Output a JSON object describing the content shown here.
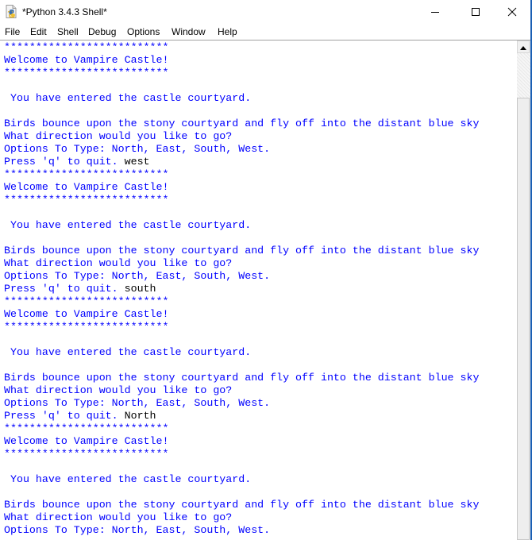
{
  "window": {
    "title": "*Python 3.4.3 Shell*",
    "icon": "idle-python-file-icon",
    "controls": {
      "minimize_icon": "minimize-icon",
      "maximize_icon": "maximize-icon",
      "close_icon": "close-icon"
    }
  },
  "menubar": {
    "items": [
      "File",
      "Edit",
      "Shell",
      "Debug",
      "Options",
      "Window",
      "Help"
    ]
  },
  "colors": {
    "output_text": "#0000ff",
    "input_text": "#000000",
    "background": "#ffffff"
  },
  "shell": {
    "lines": [
      {
        "out": "**************************",
        "in": ""
      },
      {
        "out": "Welcome to Vampire Castle!",
        "in": ""
      },
      {
        "out": "**************************",
        "in": ""
      },
      {
        "out": "",
        "in": ""
      },
      {
        "out": " You have entered the castle courtyard.",
        "in": ""
      },
      {
        "out": "",
        "in": ""
      },
      {
        "out": "Birds bounce upon the stony courtyard and fly off into the distant blue sky",
        "in": ""
      },
      {
        "out": "What direction would you like to go?",
        "in": ""
      },
      {
        "out": "Options To Type: North, East, South, West.",
        "in": ""
      },
      {
        "out": "Press 'q' to quit. ",
        "in": "west"
      },
      {
        "out": "**************************",
        "in": ""
      },
      {
        "out": "Welcome to Vampire Castle!",
        "in": ""
      },
      {
        "out": "**************************",
        "in": ""
      },
      {
        "out": "",
        "in": ""
      },
      {
        "out": " You have entered the castle courtyard.",
        "in": ""
      },
      {
        "out": "",
        "in": ""
      },
      {
        "out": "Birds bounce upon the stony courtyard and fly off into the distant blue sky",
        "in": ""
      },
      {
        "out": "What direction would you like to go?",
        "in": ""
      },
      {
        "out": "Options To Type: North, East, South, West.",
        "in": ""
      },
      {
        "out": "Press 'q' to quit. ",
        "in": "south"
      },
      {
        "out": "**************************",
        "in": ""
      },
      {
        "out": "Welcome to Vampire Castle!",
        "in": ""
      },
      {
        "out": "**************************",
        "in": ""
      },
      {
        "out": "",
        "in": ""
      },
      {
        "out": " You have entered the castle courtyard.",
        "in": ""
      },
      {
        "out": "",
        "in": ""
      },
      {
        "out": "Birds bounce upon the stony courtyard and fly off into the distant blue sky",
        "in": ""
      },
      {
        "out": "What direction would you like to go?",
        "in": ""
      },
      {
        "out": "Options To Type: North, East, South, West.",
        "in": ""
      },
      {
        "out": "Press 'q' to quit. ",
        "in": "North"
      },
      {
        "out": "**************************",
        "in": ""
      },
      {
        "out": "Welcome to Vampire Castle!",
        "in": ""
      },
      {
        "out": "**************************",
        "in": ""
      },
      {
        "out": "",
        "in": ""
      },
      {
        "out": " You have entered the castle courtyard.",
        "in": ""
      },
      {
        "out": "",
        "in": ""
      },
      {
        "out": "Birds bounce upon the stony courtyard and fly off into the distant blue sky",
        "in": ""
      },
      {
        "out": "What direction would you like to go?",
        "in": ""
      },
      {
        "out": "Options To Type: North, East, South, West.",
        "in": ""
      }
    ]
  },
  "scrollbar": {
    "up_arrow_icon": "arrow-up-icon",
    "position_fraction": 0.11
  }
}
